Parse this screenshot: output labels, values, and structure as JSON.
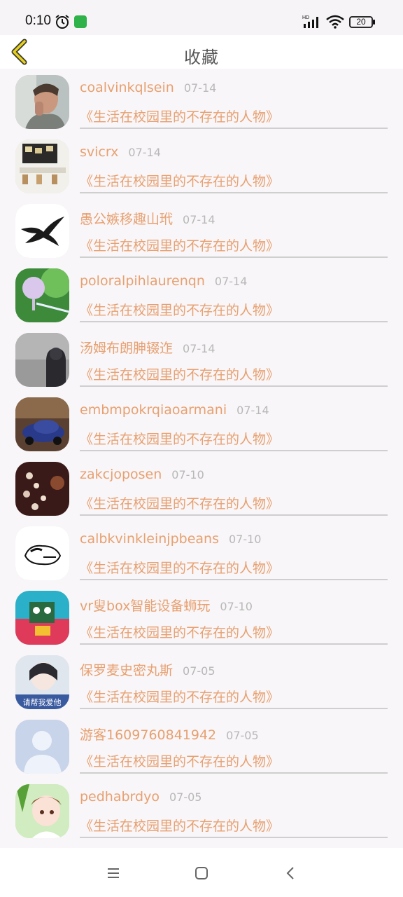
{
  "status_bar": {
    "time": "0:10",
    "battery": "20",
    "network": "HD"
  },
  "header": {
    "title": "收藏"
  },
  "items": [
    {
      "name": "coalvinkqlsein",
      "date": "07-14",
      "title": "《生活在校园里的不存在的人物》",
      "avatar": "man-portrait"
    },
    {
      "name": "svicrx",
      "date": "07-14",
      "title": "《生活在校园里的不存在的人物》",
      "avatar": "photo-wall"
    },
    {
      "name": "愚公嫉移趣山玳",
      "date": "07-14",
      "title": "《生活在校园里的不存在的人物》",
      "avatar": "swallow-bird"
    },
    {
      "name": "poloralpihlaurenqn",
      "date": "07-14",
      "title": "《生活在校园里的不存在的人物》",
      "avatar": "wind-chime"
    },
    {
      "name": "汤姆布朗胂辍迮",
      "date": "07-14",
      "title": "《生活在校园里的不存在的人物》",
      "avatar": "hooded-figure"
    },
    {
      "name": "embmpokrqiaoarmani",
      "date": "07-14",
      "title": "《生活在校园里的不存在的人物》",
      "avatar": "toy-car"
    },
    {
      "name": "zakcjoposen",
      "date": "07-10",
      "title": "《生活在校园里的不存在的人物》",
      "avatar": "blossom-branch"
    },
    {
      "name": "calbkvinkleinjpbeans",
      "date": "07-10",
      "title": "《生活在校园里的不存在的人物》",
      "avatar": "sleeping-sketch"
    },
    {
      "name": "vr叟box智能设备蛳玩",
      "date": "07-10",
      "title": "《生活在校园里的不存在的人物》",
      "avatar": "cartoon-poster"
    },
    {
      "name": "保罗麦史密丸斯",
      "date": "07-05",
      "title": "《生活在校园里的不存在的人物》",
      "avatar": "girl-face",
      "avatar_caption": "请帮我爱他"
    },
    {
      "name": "游客1609760841942",
      "date": "07-05",
      "title": "《生活在校园里的不存在的人物》",
      "avatar": "default-user"
    },
    {
      "name": "pedhabrdyo",
      "date": "07-05",
      "title": "《生活在校园里的不存在的人物》",
      "avatar": "anime-girl"
    }
  ],
  "colors": {
    "accent": "#e8a070",
    "date": "#b8b8b8",
    "divider": "#cfcfcf",
    "back_icon": "#e8d020"
  }
}
